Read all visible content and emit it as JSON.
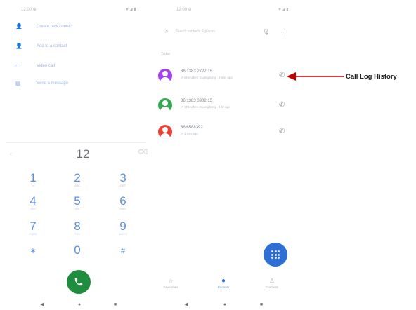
{
  "left_screen": {
    "status_time": "12:00 ⊕",
    "status_icons": "▼◢ ▮",
    "menu": [
      {
        "icon": "person-add-icon",
        "glyph": "👤",
        "label": "Create new contact"
      },
      {
        "icon": "person-add-icon",
        "glyph": "👤",
        "label": "Add to a contact"
      },
      {
        "icon": "video-call-icon",
        "glyph": "▭",
        "label": "Video call"
      },
      {
        "icon": "message-icon",
        "glyph": "▤",
        "label": "Send a message"
      }
    ],
    "entered_number": "12",
    "keypad": [
      {
        "digit": "1",
        "letters": "∞"
      },
      {
        "digit": "2",
        "letters": "ABC"
      },
      {
        "digit": "3",
        "letters": "DEF"
      },
      {
        "digit": "4",
        "letters": "GHI"
      },
      {
        "digit": "5",
        "letters": "JKL"
      },
      {
        "digit": "6",
        "letters": "MNO"
      },
      {
        "digit": "7",
        "letters": "PQRS"
      },
      {
        "digit": "8",
        "letters": "TUV"
      },
      {
        "digit": "9",
        "letters": "WXYZ"
      },
      {
        "digit": "∗",
        "letters": ""
      },
      {
        "digit": "0",
        "letters": "+"
      },
      {
        "digit": "#",
        "letters": ""
      }
    ],
    "nav": {
      "back": "◀",
      "home": "●",
      "recents": "■"
    }
  },
  "right_screen": {
    "status_time": "12:00 ⊕",
    "status_icons": "▼◢ ▮",
    "search_placeholder": "Search contacts & places",
    "section_label": "Today",
    "calls": [
      {
        "number": "86 1383 2727 15",
        "detail": "↗ Shenzhen Guangdong · 2 min ago",
        "avatar_color": "#a142f4"
      },
      {
        "number": "86 1383 0902 15",
        "detail": "↗ Shenzhen Guangdong · 1 hr ago",
        "avatar_color": "#34a853"
      },
      {
        "number": "86 6588392",
        "detail": "↗ 1 min ago",
        "avatar_color": "#ea4335"
      }
    ],
    "tabs": [
      {
        "icon": "star-icon",
        "glyph": "☆",
        "label": "Favourites"
      },
      {
        "icon": "clock-icon",
        "glyph": "●",
        "label": "Recents"
      },
      {
        "icon": "contacts-icon",
        "glyph": "♙",
        "label": "Contacts"
      }
    ],
    "nav": {
      "back": "◀",
      "home": "●",
      "recents": "■"
    }
  },
  "annotation": {
    "label": "Call Log History",
    "color": "#c00000"
  }
}
